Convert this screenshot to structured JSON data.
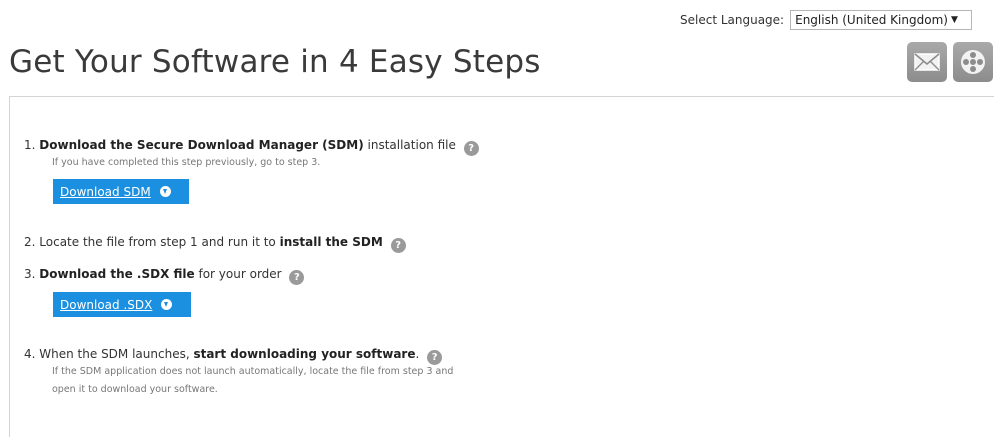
{
  "language": {
    "label": "Select Language:",
    "selected": "English (United Kingdom)"
  },
  "header": {
    "title": "Get Your Software in 4 Easy Steps",
    "email_icon": "email-icon",
    "video_icon": "video-icon"
  },
  "steps": [
    {
      "number": "1.",
      "bold": "Download the Secure Download Manager (SDM)",
      "rest": " installation file",
      "note": "If you have completed this step previously, go to step 3.",
      "button": "Download SDM"
    },
    {
      "number": "2.",
      "text": "Locate the file from step 1 and run it to ",
      "bold": "install the SDM"
    },
    {
      "number": "3.",
      "bold": "Download the .SDX file",
      "rest": " for your order",
      "button": "Download .SDX"
    },
    {
      "number": "4.",
      "text": "When the SDM launches, ",
      "bold": "start downloading your software",
      "rest": ".",
      "note_line1": "If the SDM application does not launch automatically, locate the file from step 3 and",
      "note_line2": "open it to download your software."
    }
  ],
  "help_glyph": "?"
}
